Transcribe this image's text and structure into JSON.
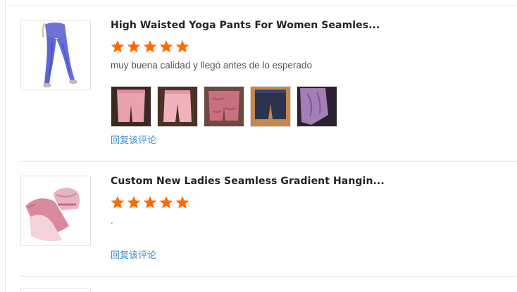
{
  "reviews": [
    {
      "product_title": "High Waisted Yoga Pants For Women Seamles...",
      "rating": 5,
      "comment": "muy buena calidad y llegó antes de lo esperado",
      "photos": [
        "pink-shorts-photo",
        "pink-shorts-photo",
        "pink-scrunch-shorts-photo",
        "navy-shorts-photo",
        "purple-fabric-photo"
      ],
      "reply_label": "回复该评论"
    },
    {
      "product_title": "Custom New Ladies Seamless Gradient Hangin...",
      "rating": 5,
      "comment": ".",
      "photos": [],
      "reply_label": "回复该评论"
    }
  ],
  "colors": {
    "star": "#ff6a00",
    "reply_link": "#3a8fd0",
    "divider": "#d9d9d9"
  }
}
